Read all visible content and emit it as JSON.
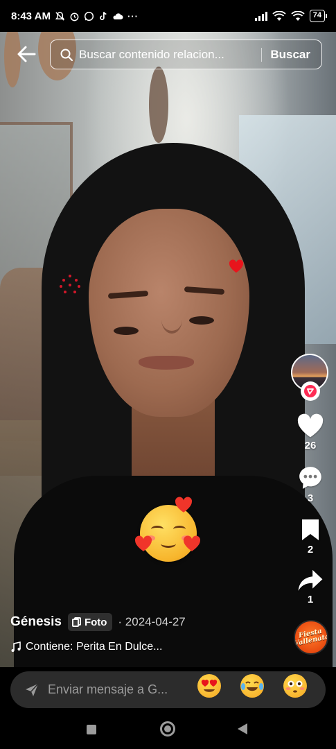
{
  "status_bar": {
    "time": "8:43 AM",
    "battery": "74"
  },
  "search": {
    "value": "Buscar contenido relacion...",
    "button_label": "Buscar"
  },
  "post": {
    "author": "Génesis",
    "type_label": "Foto",
    "date": "· 2024-04-27",
    "music": "Contiene: Perita En Dulce..."
  },
  "actions": {
    "likes": "26",
    "comments": "3",
    "saves": "2",
    "shares": "1"
  },
  "music_disc_text": "Fiesta Vallenata",
  "comment_bar": {
    "placeholder": "Enviar mensaje a G..."
  },
  "quick_emojis": [
    "heart-eyes",
    "tears-of-joy",
    "flushed"
  ],
  "colors": {
    "accent_red": "#fe2c55",
    "like_heart": "#ffffff",
    "comment_bg": "#2c2c2c"
  }
}
